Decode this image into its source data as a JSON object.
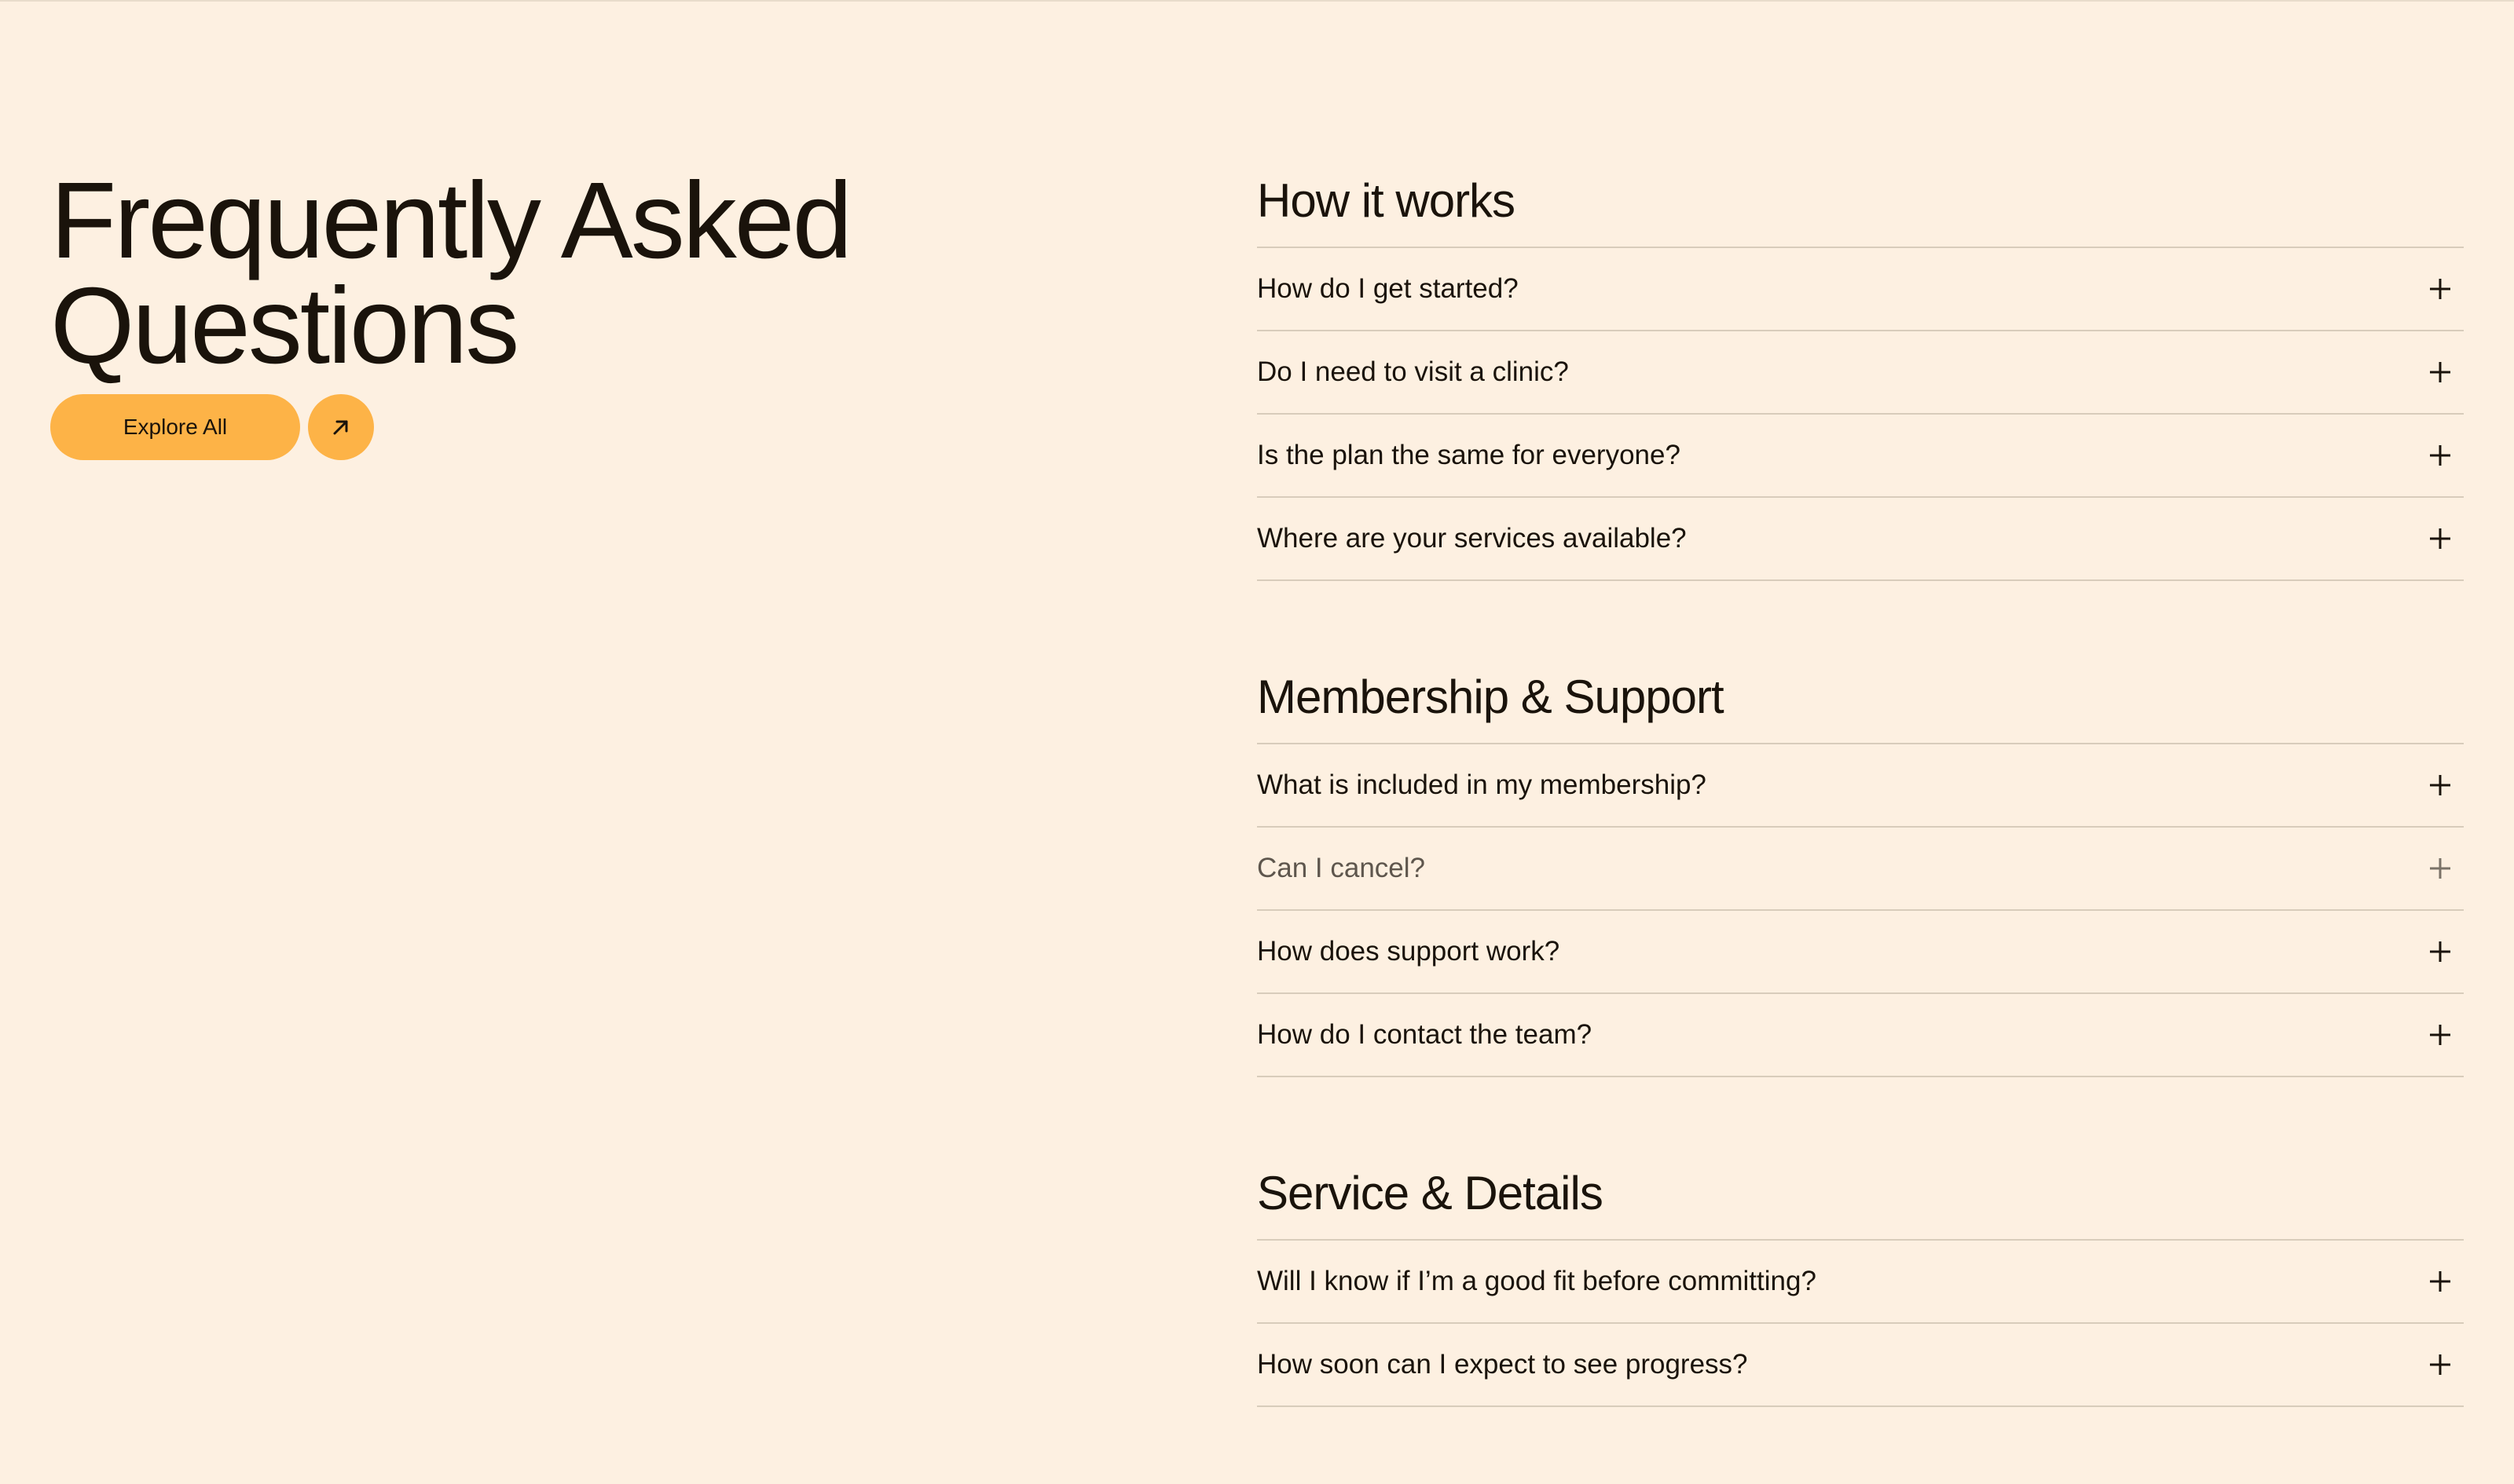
{
  "hero": {
    "title_line1": "Frequently Asked",
    "title_line2": "Questions",
    "explore_label": "Explore All",
    "arrow_icon": "arrow-up-right-icon",
    "accent_color": "#fdb347"
  },
  "sections": [
    {
      "title": "How it works",
      "items": [
        "How do I get started?",
        "Do I need to visit a clinic?",
        "Is the plan the same for everyone?",
        "Where are your services available?"
      ]
    },
    {
      "title": "Membership & Support",
      "items": [
        "What is included in my membership?",
        "Can I cancel?",
        "How does support work?",
        "How do I contact the team?"
      ]
    },
    {
      "title": "Service & Details",
      "items": [
        "Will I know if I’m a good fit before committing?",
        "How soon can I expect to see progress?"
      ]
    }
  ],
  "icons": {
    "expand": "plus-icon"
  },
  "colors": {
    "background": "#fdf0e1",
    "text": "#1a130b",
    "divider": "#d8ccbb"
  }
}
